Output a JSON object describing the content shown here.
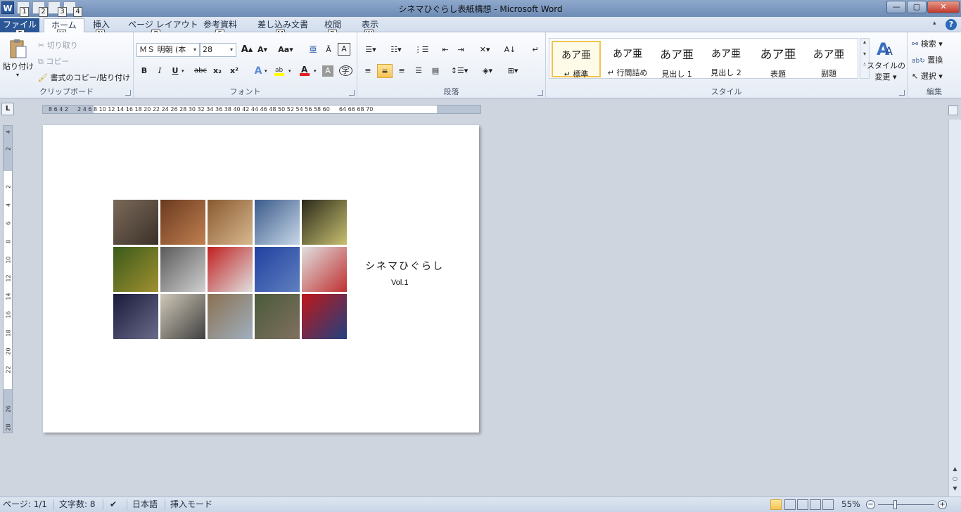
{
  "window": {
    "title": "シネマひぐらし表紙構想 - Microsoft Word",
    "logo_letter": "W",
    "qat_keytips": [
      "1",
      "2",
      "3",
      "4"
    ],
    "controls": {
      "min": "—",
      "max": "▢",
      "close": "✕"
    }
  },
  "tabs": [
    {
      "label": "ファイル",
      "keytip": "F"
    },
    {
      "label": "ホーム",
      "keytip": "H"
    },
    {
      "label": "挿入",
      "keytip": "N"
    },
    {
      "label": "ページ レイアウト",
      "keytip": "P"
    },
    {
      "label": "参考資料",
      "keytip": "S"
    },
    {
      "label": "差し込み文書",
      "keytip": "M"
    },
    {
      "label": "校閲",
      "keytip": "R"
    },
    {
      "label": "表示",
      "keytip": "W"
    }
  ],
  "help": "?",
  "clipboard": {
    "paste": "貼り付け",
    "cut": "切り取り",
    "copy": "コピー",
    "format_painter": "書式のコピー/貼り付け",
    "label": "クリップボード"
  },
  "font": {
    "name": "ＭＳ 明朝 (本",
    "size": "28",
    "grow": "A",
    "shrink": "A",
    "case": "Aa",
    "bold": "B",
    "italic": "I",
    "underline": "U",
    "strike": "abc",
    "subscript": "x₂",
    "superscript": "x²",
    "label": "フォント",
    "highlight_color": "#ffff00",
    "font_color": "#e02020"
  },
  "paragraph": {
    "label": "段落"
  },
  "styles": {
    "label": "スタイル",
    "items": [
      {
        "sample": "あア亜",
        "name": "↵ 標準"
      },
      {
        "sample": "あア亜",
        "name": "↵ 行間詰め"
      },
      {
        "sample": "あア亜",
        "name": "見出し 1"
      },
      {
        "sample": "あア亜",
        "name": "見出し 2"
      },
      {
        "sample": "あア亜",
        "name": "表題"
      },
      {
        "sample": "あア亜",
        "name": "副題"
      }
    ],
    "change": "スタイルの",
    "change2": "変更"
  },
  "editing": {
    "find": "検索",
    "replace": "置換",
    "select": "選択",
    "label": "編集"
  },
  "ruler": {
    "numbers": "8 6 4 2 　 2 4 6 8 10 12 14 16 18 20 22 24 26 28 30 32 34 36 38 40 42 44 46 48 50 52 54 56 58 60 　 64 66 68 70",
    "corner": "L",
    "vnumbers": [
      "4",
      "2",
      "",
      "2",
      "4",
      "6",
      "8",
      "10",
      "12",
      "14",
      "16",
      "18",
      "20",
      "22",
      "",
      "26",
      "28"
    ]
  },
  "document": {
    "title": "シネマひぐらし",
    "vol": "Vol.1",
    "photos": [
      [
        "#7a6a5a",
        "#3b3028"
      ],
      [
        "#6b3a1f",
        "#c08050"
      ],
      [
        "#8a5a30",
        "#d8b890"
      ],
      [
        "#3a5a8a",
        "#c8d8e8"
      ],
      [
        "#2a2a1a",
        "#c8c070"
      ],
      [
        "#3a5a1a",
        "#a09030"
      ],
      [
        "#5a5a5a",
        "#d0d0d0"
      ],
      [
        "#c02020",
        "#e0e0e0"
      ],
      [
        "#2040a0",
        "#6080c0"
      ],
      [
        "#e0e0e0",
        "#c03030"
      ],
      [
        "#1a1a3a",
        "#6a6a8a"
      ],
      [
        "#d0c8b8",
        "#404040"
      ],
      [
        "#8a7050",
        "#a0b0c0"
      ],
      [
        "#4a5a3a",
        "#807060"
      ],
      [
        "#c01818",
        "#204080"
      ]
    ]
  },
  "status": {
    "page": "ページ: 1/1",
    "words": "文字数: 8",
    "lang": "日本語",
    "mode": "挿入モード",
    "zoom": "55%",
    "zoom_minus": "−",
    "zoom_plus": "+"
  }
}
